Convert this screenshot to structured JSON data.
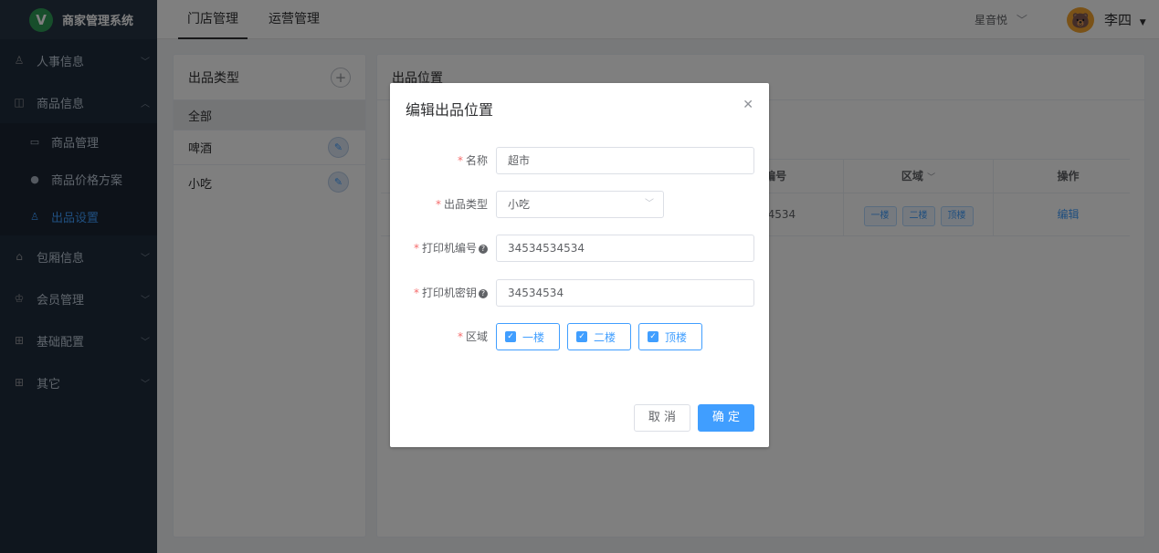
{
  "app": {
    "title": "商家管理系统",
    "logo_letter": "V"
  },
  "header": {
    "tabs": [
      {
        "label": "门店管理",
        "active": true
      },
      {
        "label": "运营管理",
        "active": false
      }
    ],
    "store": "星音悦",
    "user": "李四"
  },
  "sidebar": {
    "items": [
      {
        "label": "人事信息",
        "icon": "person-icon"
      },
      {
        "label": "商品信息",
        "icon": "goods-icon",
        "expanded": true,
        "children": [
          {
            "label": "商品管理",
            "icon": "product-icon"
          },
          {
            "label": "商品价格方案",
            "icon": "money-bag-icon"
          },
          {
            "label": "出品设置",
            "icon": "user-icon",
            "active": true
          }
        ]
      },
      {
        "label": "包厢信息",
        "icon": "home-icon"
      },
      {
        "label": "会员管理",
        "icon": "crown-icon"
      },
      {
        "label": "基础配置",
        "icon": "grid-icon"
      },
      {
        "label": "其它",
        "icon": "grid-icon"
      }
    ]
  },
  "left_panel": {
    "title": "出品类型",
    "categories": [
      "全部",
      "啤酒",
      "小吃"
    ]
  },
  "right_panel": {
    "title": "出品位置",
    "columns": {
      "printer_no_partial": "l编号",
      "area": "区域",
      "action": "操作"
    },
    "row": {
      "printer_no_partial": "34534",
      "areas": [
        "一楼",
        "二楼",
        "顶楼"
      ],
      "action": "编辑"
    }
  },
  "dialog": {
    "title": "编辑出品位置",
    "fields": {
      "name": {
        "label": "名称",
        "value": "超市"
      },
      "type": {
        "label": "出品类型",
        "value": "小吃"
      },
      "printer_no": {
        "label": "打印机编号",
        "value": "34534534534"
      },
      "printer_key": {
        "label": "打印机密钥",
        "value": "34534534"
      },
      "area": {
        "label": "区域",
        "options": [
          "一楼",
          "二楼",
          "顶楼"
        ]
      }
    },
    "cancel": "取 消",
    "confirm": "确 定"
  },
  "colors": {
    "primary": "#409eff",
    "sidebar_bg": "#1f2d3d",
    "required": "#f56c6c"
  }
}
